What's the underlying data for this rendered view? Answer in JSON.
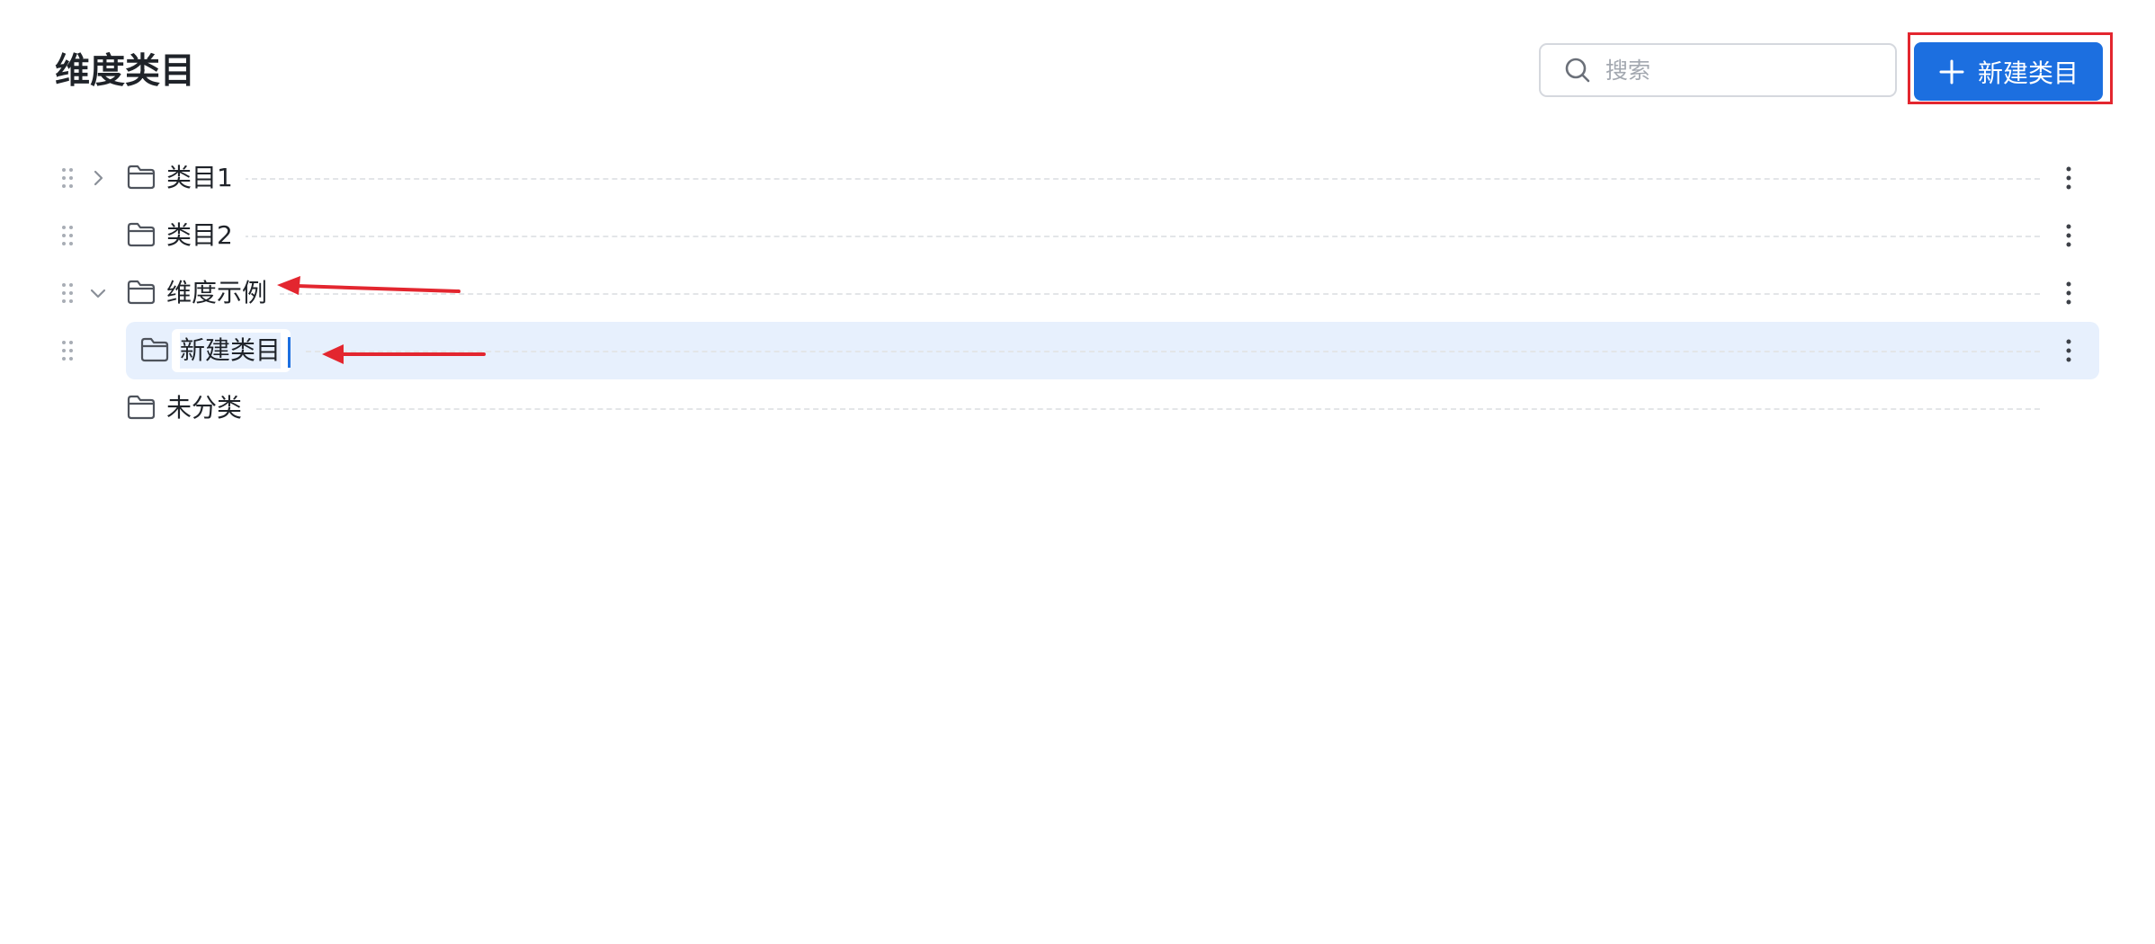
{
  "header": {
    "title": "维度类目",
    "search": {
      "placeholder": "搜索",
      "value": ""
    },
    "new_button_label": "新建类目"
  },
  "tree": [
    {
      "label": "类目1",
      "expanded": false,
      "has_children": true
    },
    {
      "label": "类目2",
      "has_children": false
    },
    {
      "label": "维度示例",
      "expanded": true,
      "has_children": true
    },
    {
      "label": "新建类目",
      "editing": true,
      "selected": true,
      "parent": "维度示例"
    },
    {
      "label": "未分类",
      "has_children": false
    }
  ],
  "colors": {
    "primary": "#1c6fe0",
    "selected_row_bg": "#e7f0fd",
    "annotation_red": "#e3262f"
  },
  "icons": [
    "search-icon",
    "plus-icon",
    "drag-handle-icon",
    "chevron-right-icon",
    "chevron-down-icon",
    "folder-icon",
    "more-vertical-icon"
  ]
}
